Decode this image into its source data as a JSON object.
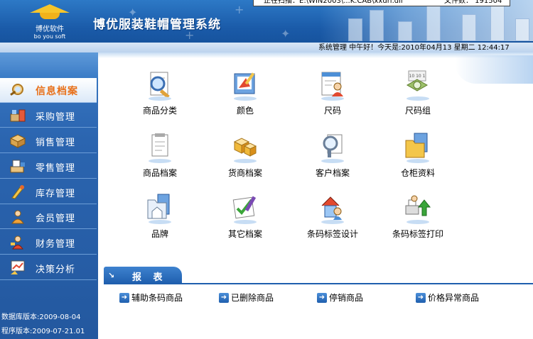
{
  "header": {
    "title": "博优服装鞋帽管理系统",
    "logo_cn": "博优软件",
    "logo_en": "bo you soft",
    "scan_text": "正在扫描：E:\\WIN2003\\...K.CAB\\xxdri.dll",
    "file_count": "文件数： 191504",
    "status_line": "系统管理  中午好！今天是:2010年04月13  星期二    12:44:17"
  },
  "sidebar": {
    "items": [
      {
        "label": "信息档案",
        "icon": "magnifier-icon",
        "active": true
      },
      {
        "label": "采购管理",
        "icon": "purchase-icon",
        "active": false
      },
      {
        "label": "销售管理",
        "icon": "sales-box-icon",
        "active": false
      },
      {
        "label": "零售管理",
        "icon": "retail-icon",
        "active": false
      },
      {
        "label": "库存管理",
        "icon": "inventory-icon",
        "active": false
      },
      {
        "label": "会员管理",
        "icon": "member-icon",
        "active": false
      },
      {
        "label": "财务管理",
        "icon": "finance-icon",
        "active": false
      },
      {
        "label": "决策分析",
        "icon": "analysis-chart-icon",
        "active": false
      }
    ],
    "db_version": "数据库版本:2009-08-04",
    "app_version": "程序版本:2009-07-21.01"
  },
  "main": {
    "tiles": [
      {
        "label": "商品分类",
        "icon": "search-document-icon"
      },
      {
        "label": "颜色",
        "icon": "color-palette-icon"
      },
      {
        "label": "尺码",
        "icon": "size-user-icon"
      },
      {
        "label": "尺码组",
        "icon": "size-group-icon"
      },
      {
        "label": "商品档案",
        "icon": "document-icon"
      },
      {
        "label": "货商档案",
        "icon": "supplier-cubes-icon"
      },
      {
        "label": "客户档案",
        "icon": "customer-search-icon"
      },
      {
        "label": "仓柜资料",
        "icon": "warehouse-folder-icon"
      },
      {
        "label": "品牌",
        "icon": "brand-folder-icon"
      },
      {
        "label": "其它档案",
        "icon": "other-files-icon"
      },
      {
        "label": "条码标签设计",
        "icon": "barcode-design-icon"
      },
      {
        "label": "条码标签打印",
        "icon": "barcode-print-icon"
      }
    ],
    "reports": {
      "title": "报 表",
      "links": [
        {
          "label": "辅助条码商品"
        },
        {
          "label": "已删除商品"
        },
        {
          "label": "停销商品"
        },
        {
          "label": "价格异常商品"
        }
      ]
    }
  },
  "colors": {
    "header_blue": "#1a5aa8",
    "sidebar_blue": "#2b65b0",
    "active_label": "#e8701a",
    "report_blue": "#1f5fae"
  }
}
